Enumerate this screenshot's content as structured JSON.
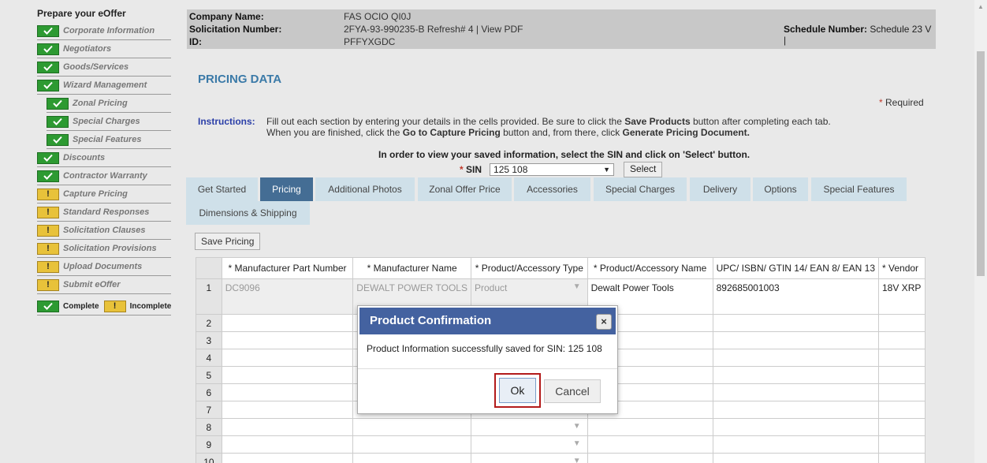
{
  "sidebar": {
    "title": "Prepare your eOffer",
    "items": [
      {
        "label": "Corporate Information",
        "status": "complete",
        "sub": false
      },
      {
        "label": "Negotiators",
        "status": "complete",
        "sub": false
      },
      {
        "label": "Goods/Services",
        "status": "complete",
        "sub": false
      },
      {
        "label": "Wizard Management",
        "status": "complete",
        "sub": false
      },
      {
        "label": "Zonal Pricing",
        "status": "complete",
        "sub": true
      },
      {
        "label": "Special Charges",
        "status": "complete",
        "sub": true
      },
      {
        "label": "Special Features",
        "status": "complete",
        "sub": true
      },
      {
        "label": "Discounts",
        "status": "complete",
        "sub": false
      },
      {
        "label": "Contractor Warranty",
        "status": "complete",
        "sub": false
      },
      {
        "label": "Capture Pricing",
        "status": "incomplete",
        "sub": false
      },
      {
        "label": "Standard Responses",
        "status": "incomplete",
        "sub": false
      },
      {
        "label": "Solicitation Clauses",
        "status": "incomplete",
        "sub": false
      },
      {
        "label": "Solicitation Provisions",
        "status": "incomplete",
        "sub": false
      },
      {
        "label": "Upload Documents",
        "status": "incomplete",
        "sub": false
      },
      {
        "label": "Submit eOffer",
        "status": "incomplete",
        "sub": false
      }
    ],
    "legend": {
      "complete": "Complete",
      "incomplete": "Incomplete"
    }
  },
  "info": {
    "company_label": "Company Name:",
    "company_value": "FAS OCIO QI0J",
    "solicitation_label": "Solicitation Number:",
    "solicitation_value": "2FYA-93-990235-B Refresh# 4 |  View PDF",
    "id_label": "ID:",
    "id_value": "PFFYXGDC",
    "schedule_label": "Schedule Number:",
    "schedule_value": "Schedule 23 V  |"
  },
  "page": {
    "title": "PRICING DATA",
    "required": "Required",
    "instructions_label": "Instructions:",
    "instructions_line1_a": "Fill out each section by entering your details in the cells provided. Be sure to click the ",
    "instructions_line1_b": "Save Products",
    "instructions_line1_c": " button after completing each tab.",
    "instructions_line2_a": "When you are finished, click the ",
    "instructions_line2_b": "Go to Capture Pricing",
    "instructions_line2_c": " button and, from there, click ",
    "instructions_line2_d": "Generate Pricing Document.",
    "sin_hint": "In order to view your saved information, select the SIN and click on 'Select' button.",
    "sin_label": "SIN",
    "sin_value": "125 108",
    "select_button": "Select",
    "save_pricing": "Save Pricing"
  },
  "tabs": [
    "Get Started",
    "Pricing",
    "Additional Photos",
    "Zonal Offer Price",
    "Accessories",
    "Special Charges",
    "Delivery",
    "Options",
    "Special Features",
    "Dimensions & Shipping"
  ],
  "active_tab": "Pricing",
  "grid": {
    "columns": [
      "* Manufacturer Part Number",
      "* Manufacturer Name",
      "* Product/Accessory Type",
      "* Product/Accessory Name",
      "UPC/ ISBN/ GTIN 14/ EAN 8/ EAN 13",
      "* Vendor"
    ],
    "row1": [
      "DC9096",
      "DEWALT POWER TOOLS",
      "Product",
      "Dewalt Power Tools",
      "892685001003",
      "18V XRP"
    ],
    "row_numbers": [
      "1",
      "2",
      "3",
      "4",
      "5",
      "6",
      "7",
      "8",
      "9",
      "10"
    ]
  },
  "modal": {
    "title": "Product Confirmation",
    "close": "×",
    "message": "Product Information successfully saved for SIN: 125 108",
    "ok": "Ok",
    "cancel": "Cancel"
  },
  "colors": {
    "complete": "#2d9a32",
    "incomplete": "#e8c23a",
    "active_tab": "#446d94",
    "modal_header": "#4462a0",
    "highlight": "#b31b1b"
  }
}
